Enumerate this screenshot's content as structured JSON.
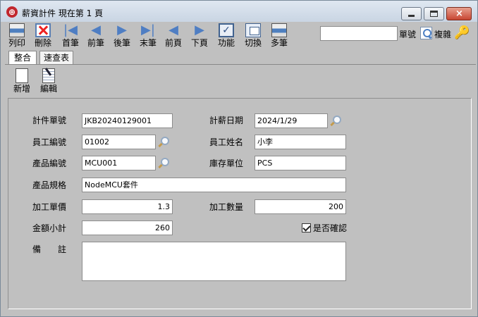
{
  "window": {
    "title": "薪資計件  現在第 1 頁",
    "app_icon": "⊕"
  },
  "toolbar": {
    "buttons": [
      {
        "label": "列印",
        "icon": "printer-icon"
      },
      {
        "label": "刪除",
        "icon": "delete-icon"
      },
      {
        "label": "首筆",
        "icon": "first-record-icon"
      },
      {
        "label": "前筆",
        "icon": "previous-record-icon"
      },
      {
        "label": "後筆",
        "icon": "next-record-icon"
      },
      {
        "label": "末筆",
        "icon": "last-record-icon"
      },
      {
        "label": "前頁",
        "icon": "previous-page-icon"
      },
      {
        "label": "下頁",
        "icon": "next-page-icon"
      },
      {
        "label": "功能",
        "icon": "function-icon"
      },
      {
        "label": "切換",
        "icon": "switch-icon"
      },
      {
        "label": "多筆",
        "icon": "multi-record-icon"
      }
    ],
    "search_value": "",
    "search_label": "單號",
    "complex_label": "複雜"
  },
  "tabs": {
    "merge": "整合",
    "quick_table": "速查表"
  },
  "actions": {
    "new": "新增",
    "edit": "編輯"
  },
  "form": {
    "piece_no_label": "計件單號",
    "piece_no": "JKB20240129001",
    "pay_date_label": "計薪日期",
    "pay_date": "2024/1/29",
    "employee_no_label": "員工編號",
    "employee_no": "01002",
    "employee_name_label": "員工姓名",
    "employee_name": "小李",
    "product_no_label": "產品編號",
    "product_no": "MCU001",
    "stock_unit_label": "庫存單位",
    "stock_unit": "PCS",
    "product_spec_label": "產品規格",
    "product_spec": "NodeMCU套件",
    "unit_price_label": "加工單價",
    "unit_price": "1.3",
    "quantity_label": "加工數量",
    "quantity": "200",
    "subtotal_label": "金額小計",
    "subtotal": "260",
    "confirmed_label": "是否確認",
    "confirmed": true,
    "remarks_label": "備　　註",
    "remarks": ""
  }
}
